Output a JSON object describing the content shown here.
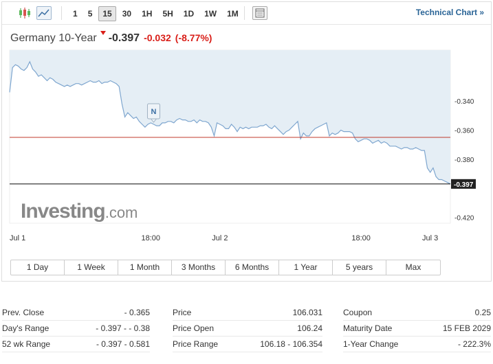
{
  "toolbar": {
    "timeframes": [
      "1",
      "5",
      "15",
      "30",
      "1H",
      "5H",
      "1D",
      "1W",
      "1M"
    ],
    "active_timeframe": "15",
    "technical_link": "Technical Chart »",
    "icons": [
      "candlestick-icon",
      "area-chart-icon",
      "settings-icon"
    ]
  },
  "quote": {
    "name": "Germany 10-Year",
    "last": "-0.397",
    "change": "-0.032",
    "change_pct": "(-8.77%)"
  },
  "colors": {
    "down": "#d91e18",
    "line": "#7ea6cf",
    "area": "#e5eef5",
    "prev_close_line": "#c0392b",
    "current_line": "#222222"
  },
  "watermark": {
    "bold": "Investing",
    "light": ".com"
  },
  "chart_data": {
    "type": "area",
    "y_ticks": [
      "-0.340",
      "-0.360",
      "-0.380",
      "-0.420"
    ],
    "y_tick_values": [
      -0.34,
      -0.36,
      -0.38,
      -0.42
    ],
    "ylim": [
      -0.424,
      -0.305
    ],
    "x_ticks": [
      "Jul 1",
      "18:00",
      "Jul 2",
      "18:00",
      "Jul 3"
    ],
    "x_tick_index": [
      0,
      49,
      73,
      122,
      146
    ],
    "num_points": 154,
    "prev_close": -0.365,
    "current_label": "-0.397",
    "current_value": -0.397,
    "event_marker": {
      "label": "N",
      "index": 50
    },
    "values": [
      -0.334,
      -0.317,
      -0.315,
      -0.316,
      -0.318,
      -0.319,
      -0.317,
      -0.313,
      -0.318,
      -0.32,
      -0.323,
      -0.322,
      -0.324,
      -0.326,
      -0.324,
      -0.325,
      -0.327,
      -0.328,
      -0.329,
      -0.33,
      -0.329,
      -0.33,
      -0.329,
      -0.328,
      -0.328,
      -0.329,
      -0.328,
      -0.327,
      -0.326,
      -0.327,
      -0.327,
      -0.326,
      -0.328,
      -0.327,
      -0.327,
      -0.326,
      -0.327,
      -0.328,
      -0.33,
      -0.342,
      -0.351,
      -0.348,
      -0.35,
      -0.352,
      -0.351,
      -0.354,
      -0.356,
      -0.358,
      -0.356,
      -0.355,
      -0.356,
      -0.357,
      -0.357,
      -0.355,
      -0.355,
      -0.354,
      -0.354,
      -0.355,
      -0.353,
      -0.352,
      -0.353,
      -0.353,
      -0.354,
      -0.354,
      -0.353,
      -0.355,
      -0.353,
      -0.354,
      -0.354,
      -0.355,
      -0.358,
      -0.364,
      -0.355,
      -0.356,
      -0.357,
      -0.359,
      -0.359,
      -0.356,
      -0.358,
      -0.361,
      -0.358,
      -0.359,
      -0.358,
      -0.359,
      -0.358,
      -0.358,
      -0.358,
      -0.357,
      -0.357,
      -0.356,
      -0.358,
      -0.359,
      -0.357,
      -0.359,
      -0.361,
      -0.363,
      -0.361,
      -0.36,
      -0.358,
      -0.356,
      -0.354,
      -0.366,
      -0.362,
      -0.364,
      -0.364,
      -0.361,
      -0.359,
      -0.358,
      -0.357,
      -0.356,
      -0.355,
      -0.364,
      -0.362,
      -0.363,
      -0.362,
      -0.36,
      -0.361,
      -0.361,
      -0.361,
      -0.362,
      -0.366,
      -0.368,
      -0.367,
      -0.366,
      -0.366,
      -0.367,
      -0.369,
      -0.368,
      -0.367,
      -0.369,
      -0.368,
      -0.369,
      -0.371,
      -0.371,
      -0.371,
      -0.372,
      -0.373,
      -0.372,
      -0.372,
      -0.373,
      -0.373,
      -0.372,
      -0.373,
      -0.374,
      -0.374,
      -0.386,
      -0.389,
      -0.386,
      -0.392,
      -0.394,
      -0.394,
      -0.395,
      -0.396,
      -0.397
    ]
  },
  "ranges": [
    "1 Day",
    "1 Week",
    "1 Month",
    "3 Months",
    "6 Months",
    "1 Year",
    "5 years",
    "Max"
  ],
  "stats": {
    "col1": [
      {
        "label": "Prev. Close",
        "value": "- 0.365"
      },
      {
        "label": "Day's Range",
        "value": "- 0.397 - - 0.38"
      },
      {
        "label": "52 wk Range",
        "value": "- 0.397 - 0.581"
      }
    ],
    "col2": [
      {
        "label": "Price",
        "value": "106.031"
      },
      {
        "label": "Price Open",
        "value": "106.24"
      },
      {
        "label": "Price Range",
        "value": "106.18 - 106.354"
      }
    ],
    "col3": [
      {
        "label": "Coupon",
        "value": "0.25"
      },
      {
        "label": "Maturity Date",
        "value": "15 FEB 2029"
      },
      {
        "label": "1-Year Change",
        "value": "- 222.3%"
      }
    ]
  }
}
